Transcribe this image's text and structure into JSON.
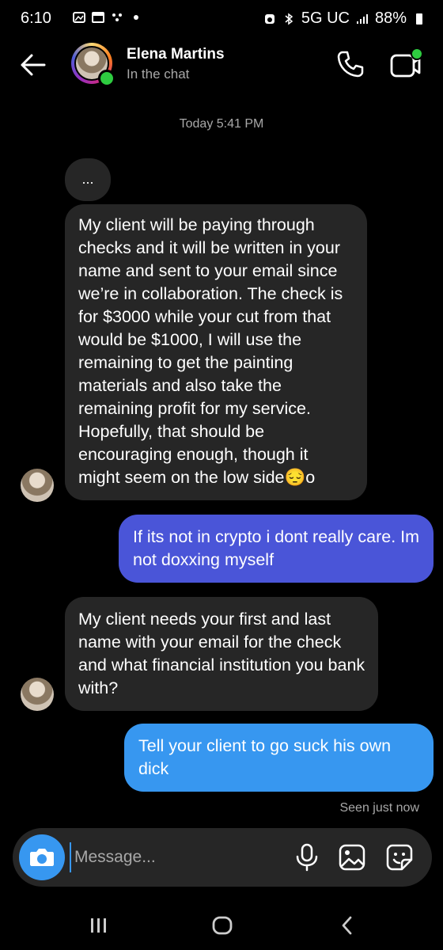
{
  "status_bar": {
    "time": "6:10",
    "network": "5G UC",
    "battery": "88%"
  },
  "header": {
    "contact_name": "Elena Martins",
    "status": "In the chat",
    "icons": [
      "back-arrow-icon",
      "phone-icon",
      "video-call-icon"
    ]
  },
  "chat": {
    "timestamp": "Today 5:41 PM",
    "messages": [
      {
        "from": "them",
        "text": "..."
      },
      {
        "from": "them",
        "text": "My client will be paying through checks and it will be written in your name and sent to your email since we’re in collaboration. The check is for $3000 while your cut from that would be $1000, I will use the remaining to get the painting materials and also take the remaining profit for my service. Hopefully, that should be encouraging enough, though it might seem on the low side😔o"
      },
      {
        "from": "me",
        "text": "If its not in crypto i dont really care. Im not doxxing myself"
      },
      {
        "from": "them",
        "text": "My client needs your first and last name with your email for the check and what financial institution you bank with?"
      },
      {
        "from": "me",
        "text": "Tell your client to go suck his own dick"
      }
    ],
    "seen_status": "Seen just now"
  },
  "composer": {
    "placeholder": "Message..."
  },
  "colors": {
    "background": "#000000",
    "incoming_bubble": "#262626",
    "outgoing_purple": "#4a55d8",
    "outgoing_blue": "#3797f0",
    "online": "#2ecc40"
  }
}
